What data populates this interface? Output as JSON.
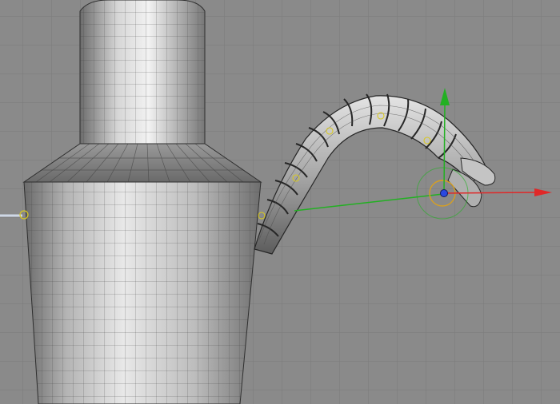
{
  "viewport": {
    "background_color": "#8a8a8a",
    "grid_color": "#7a7a7a",
    "gizmo_colors": {
      "x_axis": "#e02828",
      "y_axis": "#22b022",
      "pivot": "#2a48e0",
      "ring": "#d8a020",
      "joint": "#d8c820"
    }
  },
  "icons": {
    "x_axis_arrow": "arrow-right-icon",
    "y_axis_arrow": "arrow-up-icon",
    "pivot": "dot-icon"
  }
}
